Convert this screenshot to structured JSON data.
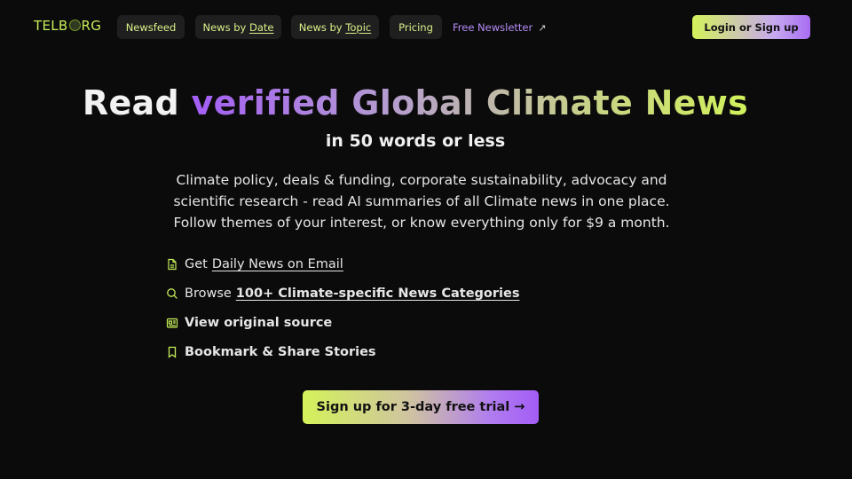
{
  "nav": {
    "logo_left": "TELB",
    "logo_right": "RG",
    "items": [
      {
        "pre": "Newsfeed",
        "link": ""
      },
      {
        "pre": "News by ",
        "link": "Date"
      },
      {
        "pre": "News by ",
        "link": "Topic"
      },
      {
        "pre": "Pricing",
        "link": ""
      }
    ],
    "newsletter_label": "Free Newsletter",
    "newsletter_arrow": "↗",
    "login_label": "Login or Sign up"
  },
  "hero": {
    "headline_read": "Read",
    "headline_highlight": "verified Global Climate News",
    "subheadline": "in 50 words or less",
    "description": "Climate policy, deals & funding, corporate sustainability, advocacy and scientific research - read AI summaries of all Climate news in one place. Follow themes of your interest, or know everything only for $9 a month."
  },
  "features": [
    {
      "icon": "document-icon",
      "pre": "Get",
      "link": "Daily News on Email",
      "bold": ""
    },
    {
      "icon": "search-icon",
      "pre": "Browse",
      "link": "100+ Climate-specific News Categories",
      "bold": ""
    },
    {
      "icon": "newspaper-icon",
      "pre": "",
      "link": "",
      "bold": "View original source"
    },
    {
      "icon": "bookmark-icon",
      "pre": "",
      "link": "",
      "bold": "Bookmark & Share Stories"
    }
  ],
  "cta": {
    "label": "Sign up for 3-day free trial →"
  },
  "colors": {
    "accent_green": "#d4f25a",
    "accent_purple": "#a35df5",
    "background": "#0b0b0b"
  }
}
